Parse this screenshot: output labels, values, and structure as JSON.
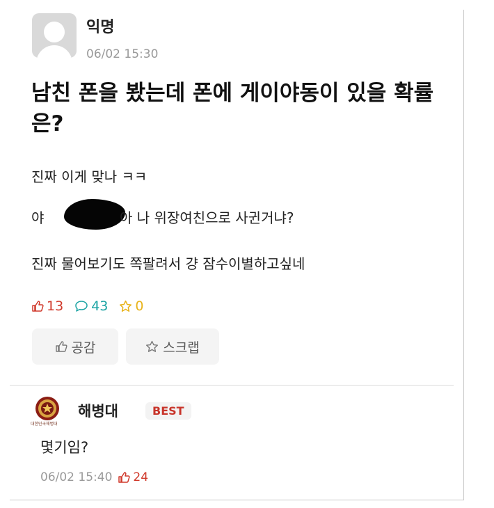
{
  "post": {
    "author": "익명",
    "time": "06/02 15:30",
    "title": "남친 폰을 봤는데 폰에 게이야동이 있을 확률은?",
    "lines": [
      "진짜 이게 맞나 ㅋㅋ",
      "야 ",
      "아 나 위장여친으로 사귄거냐?",
      "진짜 물어보기도 쪽팔려서 걍 잠수이별하고싶네"
    ],
    "stats": {
      "likes": "13",
      "comments": "43",
      "scraps": "0"
    },
    "buttons": {
      "vote": "공감",
      "scrap": "스크랩"
    }
  },
  "comment": {
    "author": "해병대",
    "badge": "BEST",
    "emblem_caption": "대한민국해병대",
    "text": "몇기임?",
    "time": "06/02 15:40",
    "likes": "24"
  },
  "colors": {
    "like": "#d0392b",
    "comment": "#1aa3a3",
    "scrap": "#e8b31a",
    "meta_gray": "#9a9a9a"
  }
}
